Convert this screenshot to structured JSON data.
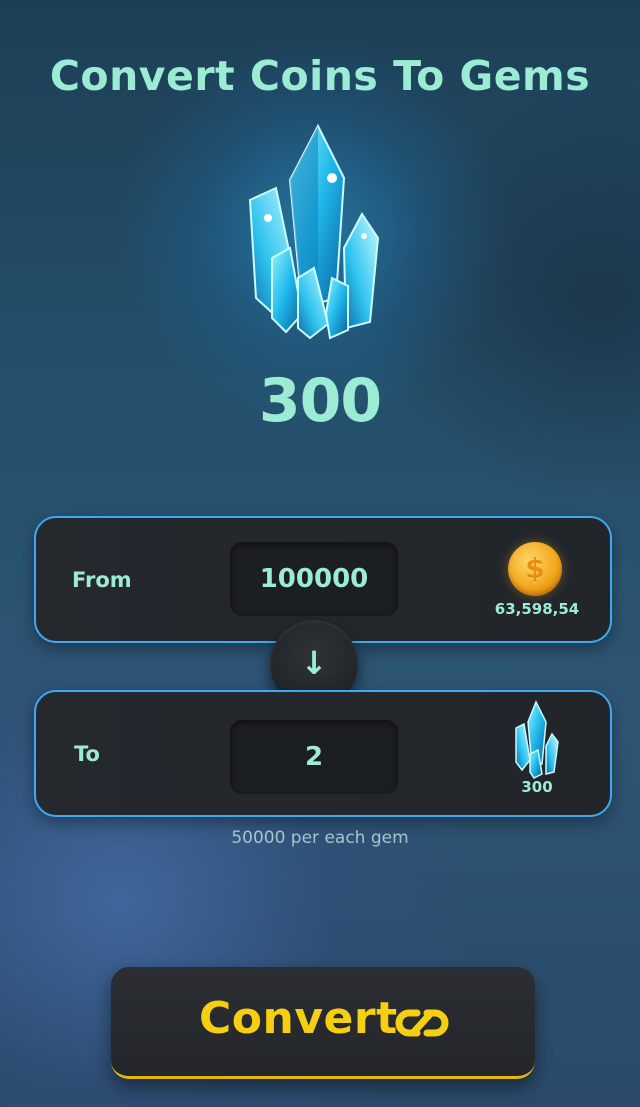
{
  "screen": {
    "title": "Convert Coins To Gems",
    "hero_gem_amount": "300"
  },
  "from_card": {
    "label": "From",
    "amount": "100000",
    "currency_icon": "coin-icon",
    "balance": "63,598,54"
  },
  "swap": {
    "icon": "arrow-down-icon",
    "glyph": "↓"
  },
  "to_card": {
    "label": "To",
    "amount": "2",
    "currency_icon": "gem-icon",
    "balance": "300"
  },
  "rate_text": "50000 per each gem",
  "convert_button": {
    "label": "Convert",
    "icon": "link-icon"
  },
  "colors": {
    "accent_text": "#9cebd5",
    "card_border": "#3ea9f0",
    "convert_text": "#f6cf12",
    "coin": "#f2a81c"
  }
}
